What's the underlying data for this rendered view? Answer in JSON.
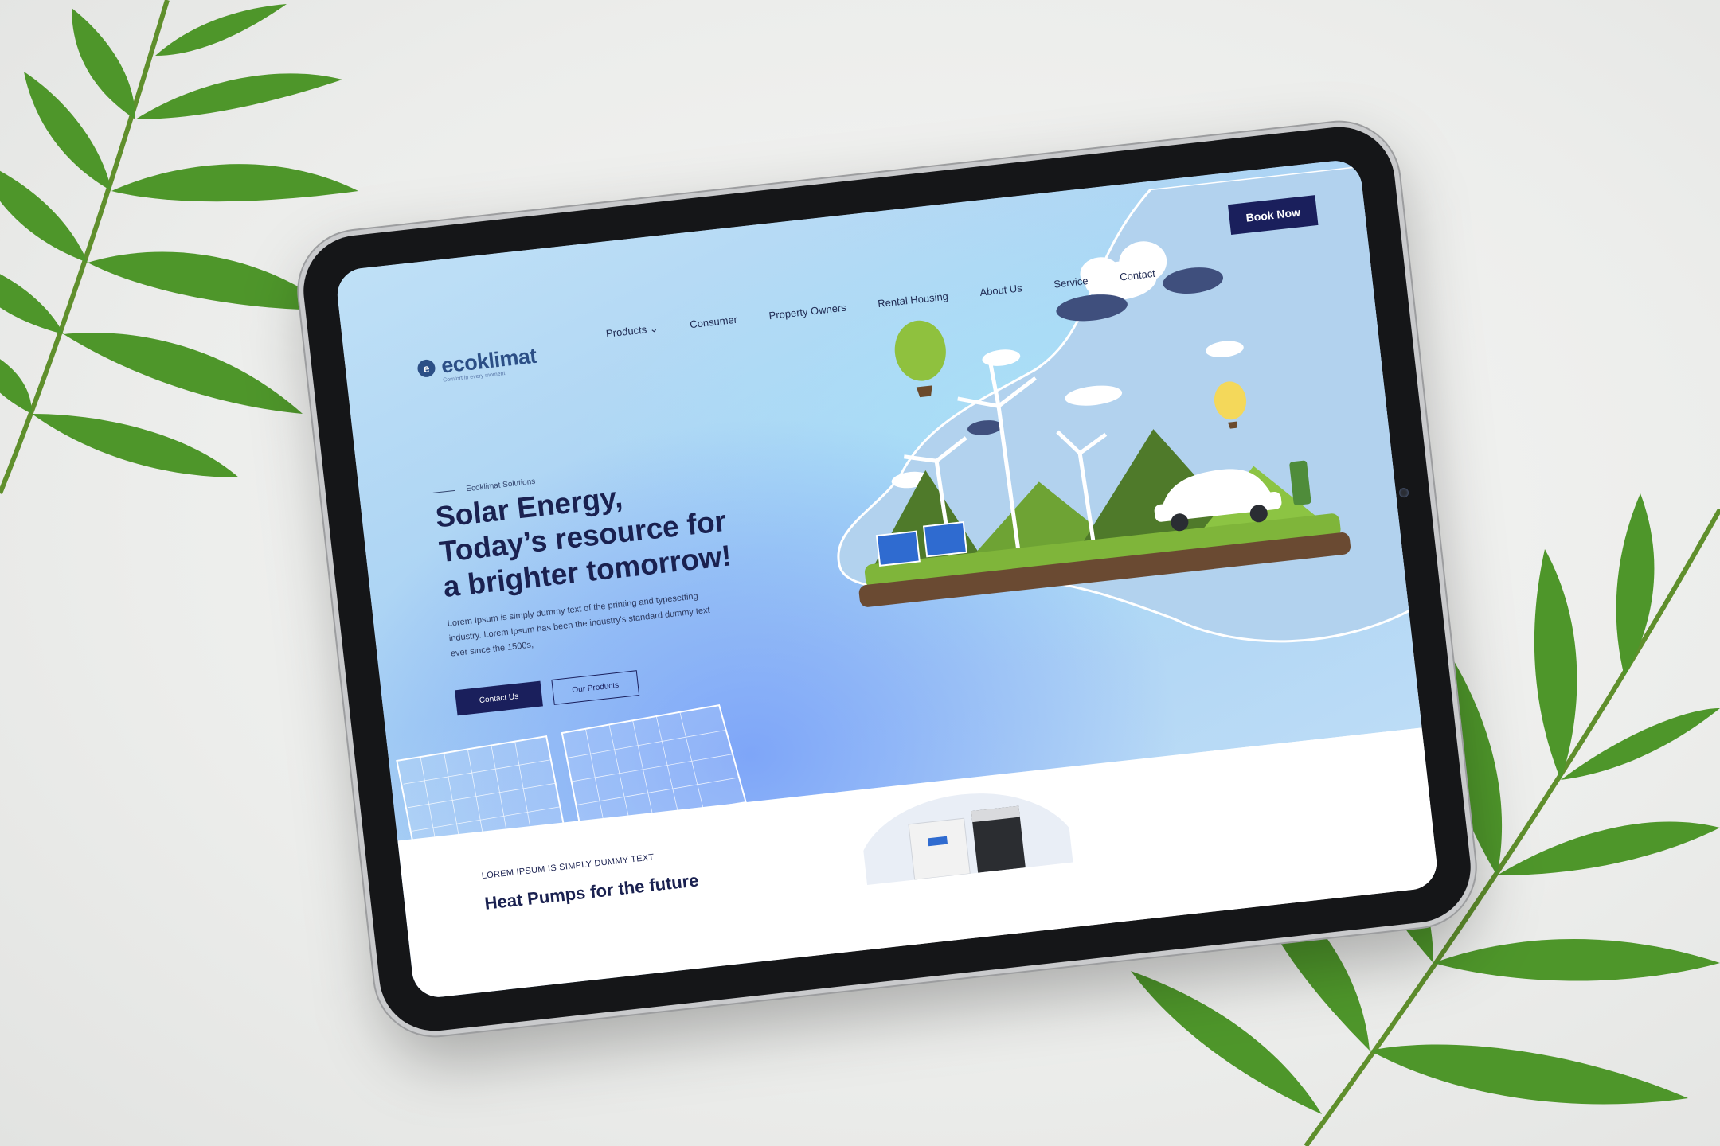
{
  "background": {
    "color": "#ededeb",
    "leaf_color": "#4f9a2a"
  },
  "site": {
    "logo": {
      "name": "ecoklimat",
      "tagline": "Comfort in every moment"
    },
    "nav": {
      "items": [
        {
          "label": "Products",
          "has_dropdown": true
        },
        {
          "label": "Consumer"
        },
        {
          "label": "Property Owners"
        },
        {
          "label": "Rental Housing"
        },
        {
          "label": "About Us"
        },
        {
          "label": "Service"
        },
        {
          "label": "Contact"
        }
      ],
      "book_now": "Book Now"
    },
    "hero": {
      "eyebrow": "Ecoklimat Solutions",
      "headline": "Solar Energy,\nToday’s resource for\na brighter tomorrow!",
      "body": "Lorem Ipsum is simply dummy text of the printing and typesetting industry. Lorem Ipsum has been the industry's standard dummy text ever since the 1500s,",
      "primary_button": "Contact Us",
      "secondary_button": "Our Products"
    },
    "section": {
      "eyebrow": "LOREM IPSUM IS SIMPLY DUMMY TEXT",
      "title": "Heat Pumps for the future"
    },
    "colors": {
      "primary": "#1a1f5c",
      "accent": "#2c4f86",
      "hero_blue": "#a9d3f4"
    }
  }
}
